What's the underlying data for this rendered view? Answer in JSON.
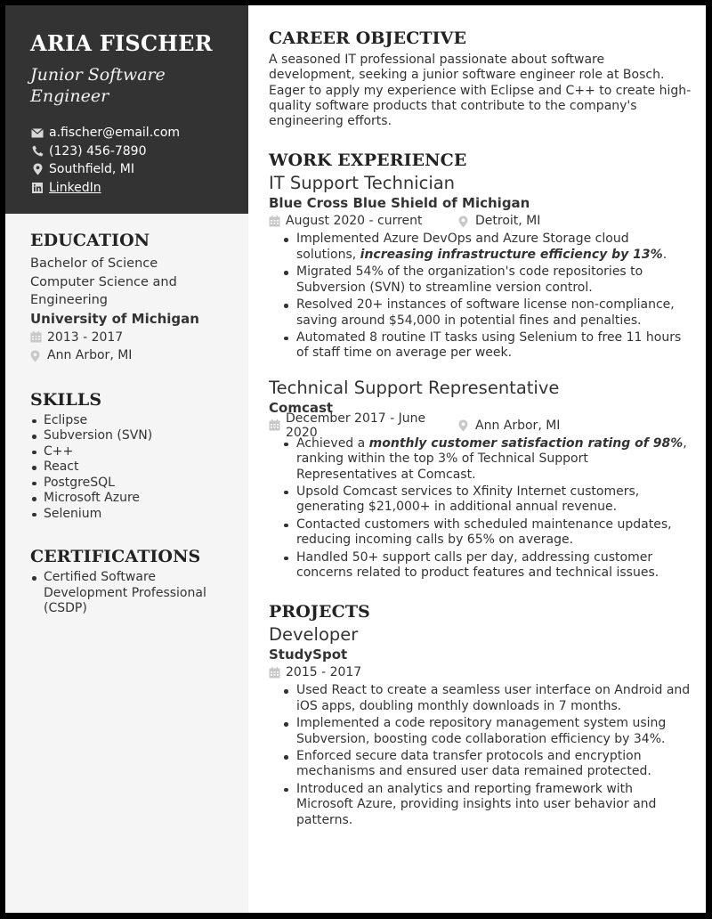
{
  "header": {
    "name": "ARIA FISCHER",
    "title": "Junior Software Engineer",
    "contacts": [
      {
        "icon": "envelope-icon",
        "text": "a.fischer@email.com",
        "link": false
      },
      {
        "icon": "phone-icon",
        "text": "(123) 456-7890",
        "link": false
      },
      {
        "icon": "map-pin-icon",
        "text": "Southfield, MI",
        "link": false
      },
      {
        "icon": "linkedin-icon",
        "text": "LinkedIn",
        "link": true
      }
    ]
  },
  "education": {
    "heading": "EDUCATION",
    "degree": "Bachelor of Science",
    "field": "Computer Science and Engineering",
    "school": "University of Michigan",
    "dates": "2013 - 2017",
    "location": "Ann Arbor, MI"
  },
  "skills": {
    "heading": "SKILLS",
    "items": [
      "Eclipse",
      "Subversion (SVN)",
      "C++",
      "React",
      "PostgreSQL",
      "Microsoft Azure",
      "Selenium"
    ]
  },
  "certifications": {
    "heading": "CERTIFICATIONS",
    "items": [
      "Certified Software Development Professional (CSDP)"
    ]
  },
  "objective": {
    "heading": "CAREER OBJECTIVE",
    "text": "A seasoned IT professional passionate about software development, seeking a junior software engineer role at Bosch. Eager to apply my experience with Eclipse and C++ to create high-quality software products that contribute to the company's engineering efforts."
  },
  "experience": {
    "heading": "WORK EXPERIENCE",
    "jobs": [
      {
        "title": "IT Support Technician",
        "company": "Blue Cross Blue Shield of Michigan",
        "dates": "August 2020 - current",
        "location": "Detroit, MI",
        "bullets": [
          {
            "pre": "Implemented Azure DevOps and Azure Storage cloud solutions, ",
            "em": "increasing infrastructure efficiency by 13%",
            "post": "."
          },
          {
            "pre": "Migrated 54% of the organization's code repositories to Subversion (SVN) to streamline version control.",
            "em": "",
            "post": ""
          },
          {
            "pre": "Resolved 20+ instances of software license non-compliance, saving around $54,000 in potential fines and penalties.",
            "em": "",
            "post": ""
          },
          {
            "pre": "Automated 8 routine IT tasks using Selenium to free 11 hours of staff time on average per week.",
            "em": "",
            "post": ""
          }
        ]
      },
      {
        "title": "Technical Support Representative",
        "company": "Comcast",
        "dates": "December 2017 - June 2020",
        "location": "Ann Arbor, MI",
        "bullets": [
          {
            "pre": "Achieved a ",
            "em": "monthly customer satisfaction rating of 98%",
            "post": ", ranking within the top 3% of Technical Support Representatives at Comcast."
          },
          {
            "pre": "Upsold Comcast services to Xfinity Internet customers, generating $21,000+ in additional annual revenue.",
            "em": "",
            "post": ""
          },
          {
            "pre": "Contacted customers with scheduled maintenance updates, reducing incoming calls by 65% on average.",
            "em": "",
            "post": ""
          },
          {
            "pre": "Handled 50+ support calls per day, addressing customer concerns related to product features and technical issues.",
            "em": "",
            "post": ""
          }
        ]
      }
    ]
  },
  "projects": {
    "heading": "PROJECTS",
    "items": [
      {
        "title": "Developer",
        "company": "StudySpot",
        "dates": "2015 - 2017",
        "bullets": [
          {
            "pre": "Used React to create a seamless user interface on Android and iOS apps, doubling monthly downloads in 7 months.",
            "em": "",
            "post": ""
          },
          {
            "pre": "Implemented a code repository management system using Subversion, boosting code collaboration efficiency by 34%.",
            "em": "",
            "post": ""
          },
          {
            "pre": "Enforced secure data transfer protocols and encryption mechanisms and ensured user data remained protected.",
            "em": "",
            "post": ""
          },
          {
            "pre": "Introduced an analytics and reporting framework with Microsoft Azure, providing insights into user behavior and patterns.",
            "em": "",
            "post": ""
          }
        ]
      }
    ]
  },
  "colors": {
    "header_bg": "#333333",
    "sidebar_bg": "#f5f5f5",
    "text": "#333333",
    "icon_gray": "#c8c8c8",
    "page_border": "#000000"
  }
}
